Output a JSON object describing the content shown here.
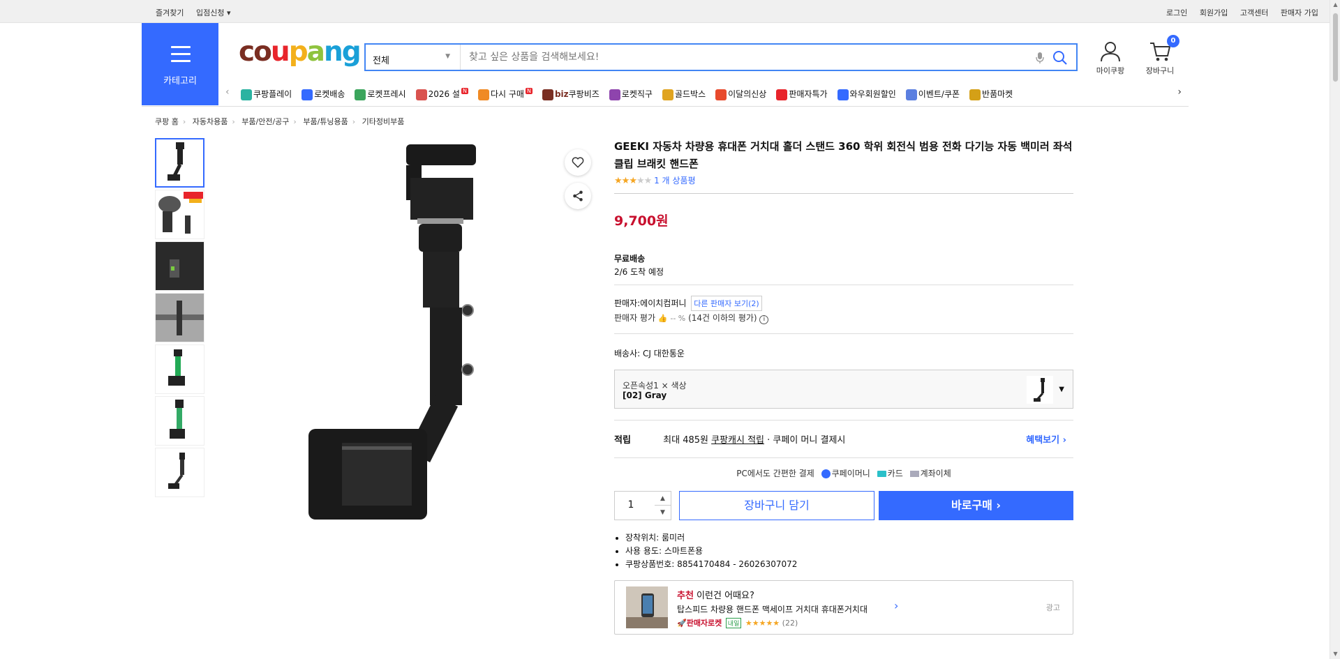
{
  "topbar": {
    "left": [
      "즐겨찾기",
      "입점신청 ▾"
    ],
    "right": [
      "로그인",
      "회원가입",
      "고객센터",
      "판매자 가입"
    ]
  },
  "category_label": "카테고리",
  "logo": {
    "c1": "co",
    "c2": "u",
    "c3": "p",
    "c4": "a",
    "c5": "ng"
  },
  "search": {
    "category": "전체",
    "placeholder": "찾고 싶은 상품을 검색해보세요!"
  },
  "header": {
    "mypage": "마이쿠팡",
    "cart": "장바구니",
    "cart_count": "0"
  },
  "nav": [
    {
      "label": "쿠팡플레이",
      "color": "#2bb3a1"
    },
    {
      "label": "로켓배송",
      "color": "#346aff"
    },
    {
      "label": "로켓프레시",
      "color": "#3ba55c"
    },
    {
      "label": "2026 설",
      "color": "#d9534f",
      "badge": "N"
    },
    {
      "label": "다시 구매",
      "color": "#f08a24",
      "badge": "N"
    },
    {
      "label": "쿠팡비즈",
      "color": "#7a2e22",
      "prefix": "biz"
    },
    {
      "label": "로켓직구",
      "color": "#8e44ad"
    },
    {
      "label": "골드박스",
      "color": "#e0a420"
    },
    {
      "label": "이달의신상",
      "color": "#e84a2c"
    },
    {
      "label": "판매자특가",
      "color": "#e8242b"
    },
    {
      "label": "와우회원할인",
      "color": "#346aff"
    },
    {
      "label": "이벤트/쿠폰",
      "color": "#5b7fe0"
    },
    {
      "label": "반품마켓",
      "color": "#d4a017"
    }
  ],
  "breadcrumb": [
    "쿠팡 홈",
    "자동차용품",
    "부품/안전/공구",
    "부품/튜닝용품",
    "기타정비부품"
  ],
  "product": {
    "title": "GEEKI 자동차 차량용 휴대폰 거치대 홀더 스탠드 360 학위 회전식 범용 전화 다기능 자동 백미러 좌석 클립 브래킷 핸드폰",
    "rating_stars": 3,
    "review_link": "1 개 상품평",
    "price": "9,700원",
    "shipping_title": "무료배송",
    "shipping_date": "2/6 도착 예정",
    "seller_prefix": "판매자:",
    "seller_name": "에이치컴퍼니",
    "other_sellers": "다른 판매자 보기(2)",
    "seller_rating_label": "판매자 평가",
    "seller_rating_value": "-- %",
    "seller_rating_note": "(14건 이하의 평가)",
    "courier_label": "배송사:",
    "courier_value": "CJ 대한통운",
    "option_key": "오픈속성1 × 색상",
    "option_value": "[02] Gray",
    "points_label": "적립",
    "points_text": "최대 485원",
    "points_link": "쿠팡캐시 적립",
    "points_suffix": "· 쿠페이 머니 결제시",
    "benefit_link": "혜택보기 ›",
    "pay_title": "PC에서도 간편한 결제",
    "pay_money": "쿠페이머니",
    "pay_card": "카드",
    "pay_bank": "계좌이체",
    "quantity": "1",
    "cart_button": "장바구니 담기",
    "buy_button": "바로구매 ›",
    "specs": [
      "장착위치: 룸미러",
      "사용 용도: 스마트폰용",
      "쿠팡상품번호: 8854170484 - 26026307072"
    ]
  },
  "recommend": {
    "tag": "추천",
    "heading": " 이런건 어때요?",
    "name": "탑스피드 차량용 핸드폰 맥세이프 거치대 휴대폰거치대",
    "rocket": "🚀판매자로켓",
    "tomorrow": "내일",
    "stars": "★★★★★",
    "count": "(22)",
    "ad": "광고"
  }
}
